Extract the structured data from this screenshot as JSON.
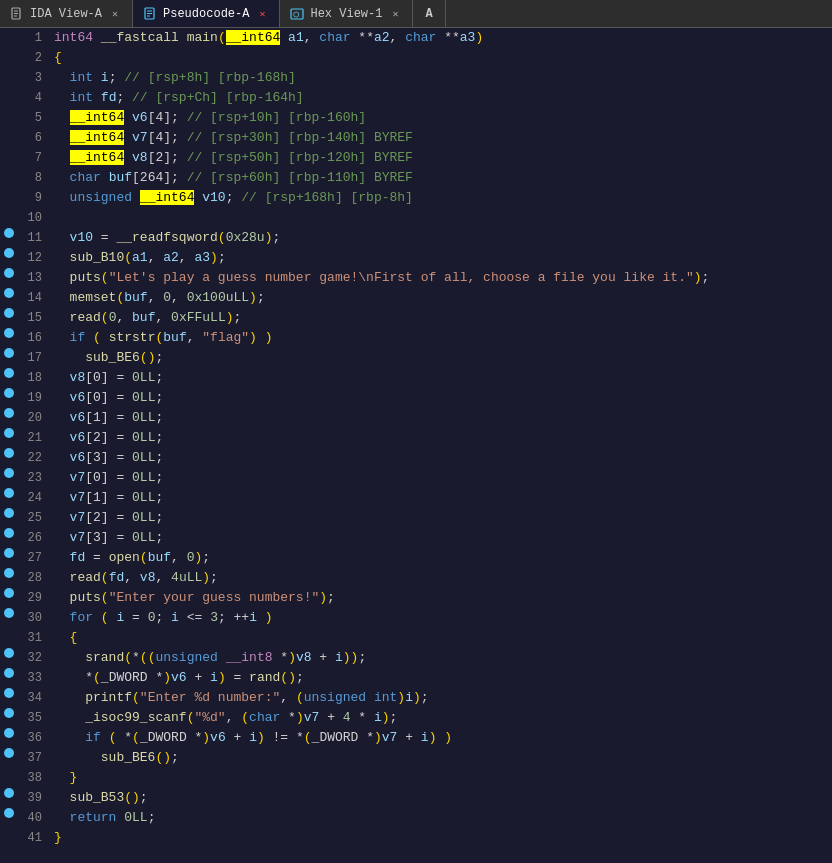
{
  "tabs": [
    {
      "id": "ida-view-a",
      "label": "IDA View-A",
      "icon": "doc",
      "active": false,
      "closable": true
    },
    {
      "id": "pseudocode-a",
      "label": "Pseudocode-A",
      "icon": "pseudo",
      "active": true,
      "closable": true
    },
    {
      "id": "hex-view-1",
      "label": "Hex View-1",
      "icon": "hex",
      "active": false,
      "closable": true
    },
    {
      "id": "a-button",
      "label": "A",
      "icon": "A",
      "active": false,
      "closable": false
    }
  ],
  "lines": [
    {
      "num": 1,
      "bp": false,
      "html": "<span class='kw2'>int64</span> <span class='fn'>__fastcall</span> <span class='fn'>main</span><span class='paren'>(</span><span class='hl-yellow'>__int64</span> <span class='var'>a1</span>, <span class='kw'>char</span> **<span class='var'>a2</span>, <span class='kw'>char</span> **<span class='var'>a3</span><span class='paren'>)</span>"
    },
    {
      "num": 2,
      "bp": false,
      "html": "<span class='paren'>{</span>"
    },
    {
      "num": 3,
      "bp": false,
      "html": "  <span class='kw'>int</span> <span class='var'>i</span>; <span class='cmt'>// [rsp+8h] [rbp-168h]</span>"
    },
    {
      "num": 4,
      "bp": false,
      "html": "  <span class='kw'>int</span> <span class='var'>fd</span>; <span class='cmt'>// [rsp+Ch] [rbp-164h]</span>"
    },
    {
      "num": 5,
      "bp": false,
      "html": "  <span class='hl-yellow'>__int64</span> <span class='var'>v6</span>[4]; <span class='cmt'>// [rsp+10h] [rbp-160h]</span>"
    },
    {
      "num": 6,
      "bp": false,
      "html": "  <span class='hl-yellow'>__int64</span> <span class='var'>v7</span>[4]; <span class='cmt'>// [rsp+30h] [rbp-140h] BYREF</span>"
    },
    {
      "num": 7,
      "bp": false,
      "html": "  <span class='hl-yellow'>__int64</span> <span class='var'>v8</span>[2]; <span class='cmt'>// [rsp+50h] [rbp-120h] BYREF</span>"
    },
    {
      "num": 8,
      "bp": false,
      "html": "  <span class='kw'>char</span> <span class='var'>buf</span>[264]; <span class='cmt'>// [rsp+60h] [rbp-110h] BYREF</span>"
    },
    {
      "num": 9,
      "bp": false,
      "html": "  <span class='kw'>unsigned</span> <span class='hl-yellow'>__int64</span> <span class='var'>v10</span>; <span class='cmt'>// [rsp+168h] [rbp-8h]</span>"
    },
    {
      "num": 10,
      "bp": false,
      "html": ""
    },
    {
      "num": 11,
      "bp": true,
      "html": "  <span class='var'>v10</span> = <span class='fn'>__readfsqword</span><span class='paren'>(</span><span class='num'>0x28u</span><span class='paren'>)</span>;"
    },
    {
      "num": 12,
      "bp": true,
      "html": "  <span class='fn'>sub_B10</span><span class='paren'>(</span><span class='var'>a1</span>, <span class='var'>a2</span>, <span class='var'>a3</span><span class='paren'>)</span>;"
    },
    {
      "num": 13,
      "bp": true,
      "html": "  <span class='fn'>puts</span><span class='paren'>(</span><span class='str'>\"Let's play a guess number game!\\nFirst of all, choose a file you like it.\"</span><span class='paren'>)</span>;"
    },
    {
      "num": 14,
      "bp": true,
      "html": "  <span class='fn'>memset</span><span class='paren'>(</span><span class='var'>buf</span>, <span class='num'>0</span>, <span class='num'>0x100uLL</span><span class='paren'>)</span>;"
    },
    {
      "num": 15,
      "bp": true,
      "html": "  <span class='fn'>read</span><span class='paren'>(</span><span class='num'>0</span>, <span class='var'>buf</span>, <span class='num'>0xFFuLL</span><span class='paren'>)</span>;"
    },
    {
      "num": 16,
      "bp": true,
      "html": "  <span class='kw'>if</span> <span class='paren'>(</span> <span class='fn'>strstr</span><span class='paren'>(</span><span class='var'>buf</span>, <span class='str'>\"flag\"</span><span class='paren'>)</span> <span class='paren'>)</span>"
    },
    {
      "num": 17,
      "bp": true,
      "html": "    <span class='fn'>sub_BE6</span><span class='paren'>()</span>;"
    },
    {
      "num": 18,
      "bp": true,
      "html": "  <span class='var'>v8</span>[0] = <span class='num'>0LL</span>;"
    },
    {
      "num": 19,
      "bp": true,
      "html": "  <span class='var'>v6</span>[0] = <span class='num'>0LL</span>;"
    },
    {
      "num": 20,
      "bp": true,
      "html": "  <span class='var'>v6</span>[1] = <span class='num'>0LL</span>;"
    },
    {
      "num": 21,
      "bp": true,
      "html": "  <span class='var'>v6</span>[2] = <span class='num'>0LL</span>;"
    },
    {
      "num": 22,
      "bp": true,
      "html": "  <span class='var'>v6</span>[3] = <span class='num'>0LL</span>;"
    },
    {
      "num": 23,
      "bp": true,
      "html": "  <span class='var'>v7</span>[0] = <span class='num'>0LL</span>;"
    },
    {
      "num": 24,
      "bp": true,
      "html": "  <span class='var'>v7</span>[1] = <span class='num'>0LL</span>;"
    },
    {
      "num": 25,
      "bp": true,
      "html": "  <span class='var'>v7</span>[2] = <span class='num'>0LL</span>;"
    },
    {
      "num": 26,
      "bp": true,
      "html": "  <span class='var'>v7</span>[3] = <span class='num'>0LL</span>;"
    },
    {
      "num": 27,
      "bp": true,
      "html": "  <span class='var'>fd</span> = <span class='fn'>open</span><span class='paren'>(</span><span class='var'>buf</span>, <span class='num'>0</span><span class='paren'>)</span>;"
    },
    {
      "num": 28,
      "bp": true,
      "html": "  <span class='fn'>read</span><span class='paren'>(</span><span class='var'>fd</span>, <span class='var'>v8</span>, <span class='num'>4uLL</span><span class='paren'>)</span>;"
    },
    {
      "num": 29,
      "bp": true,
      "html": "  <span class='fn'>puts</span><span class='paren'>(</span><span class='str'>\"Enter your guess numbers!\"</span><span class='paren'>)</span>;"
    },
    {
      "num": 30,
      "bp": true,
      "html": "  <span class='kw'>for</span> <span class='paren'>(</span> <span class='var'>i</span> = <span class='num'>0</span>; <span class='var'>i</span> &lt;= <span class='num'>3</span>; ++<span class='var'>i</span> <span class='paren'>)</span>"
    },
    {
      "num": 31,
      "bp": false,
      "html": "  <span class='paren'>{</span>"
    },
    {
      "num": 32,
      "bp": true,
      "html": "    <span class='fn'>srand</span><span class='paren'>(</span>*<span class='paren'>((</span><span class='kw'>unsigned</span> <span class='kw2'>__int8</span> *<span class='paren'>)</span><span class='var'>v8</span> + <span class='var'>i</span><span class='paren'>))</span>;"
    },
    {
      "num": 33,
      "bp": true,
      "html": "    *<span class='paren'>(</span>_DWORD *<span class='paren'>)</span><span class='var'>v6</span> + <span class='var'>i</span><span class='paren'>)</span> = <span class='fn'>rand</span><span class='paren'>()</span>;"
    },
    {
      "num": 34,
      "bp": true,
      "html": "    <span class='fn'>printf</span><span class='paren'>(</span><span class='str'>\"Enter %d number:\"</span>, <span class='paren'>(</span><span class='kw'>unsigned</span> <span class='kw'>int</span><span class='paren'>)</span><span class='var'>i</span><span class='paren'>)</span>;"
    },
    {
      "num": 35,
      "bp": true,
      "html": "    <span class='fn'>_isoc99_scanf</span><span class='paren'>(</span><span class='str'>\"%d\"</span>, <span class='paren'>(</span><span class='kw'>char</span> *<span class='paren'>)</span><span class='var'>v7</span> + <span class='num'>4</span> * <span class='var'>i</span><span class='paren'>)</span>;"
    },
    {
      "num": 36,
      "bp": true,
      "html": "    <span class='kw'>if</span> <span class='paren'>(</span> *<span class='paren'>(</span>_DWORD *<span class='paren'>)</span><span class='var'>v6</span> + <span class='var'>i</span><span class='paren'>)</span> != *<span class='paren'>(</span>_DWORD *<span class='paren'>)</span><span class='var'>v7</span> + <span class='var'>i</span><span class='paren'>)</span> <span class='paren'>)</span>"
    },
    {
      "num": 37,
      "bp": true,
      "html": "      <span class='fn'>sub_BE6</span><span class='paren'>()</span>;"
    },
    {
      "num": 38,
      "bp": false,
      "html": "  <span class='paren'>}</span>"
    },
    {
      "num": 39,
      "bp": true,
      "html": "  <span class='fn'>sub_B53</span><span class='paren'>()</span>;"
    },
    {
      "num": 40,
      "bp": true,
      "html": "  <span class='kw'>return</span> <span class='num'>0LL</span>;"
    },
    {
      "num": 41,
      "bp": false,
      "html": "<span class='paren'>}</span>"
    }
  ]
}
